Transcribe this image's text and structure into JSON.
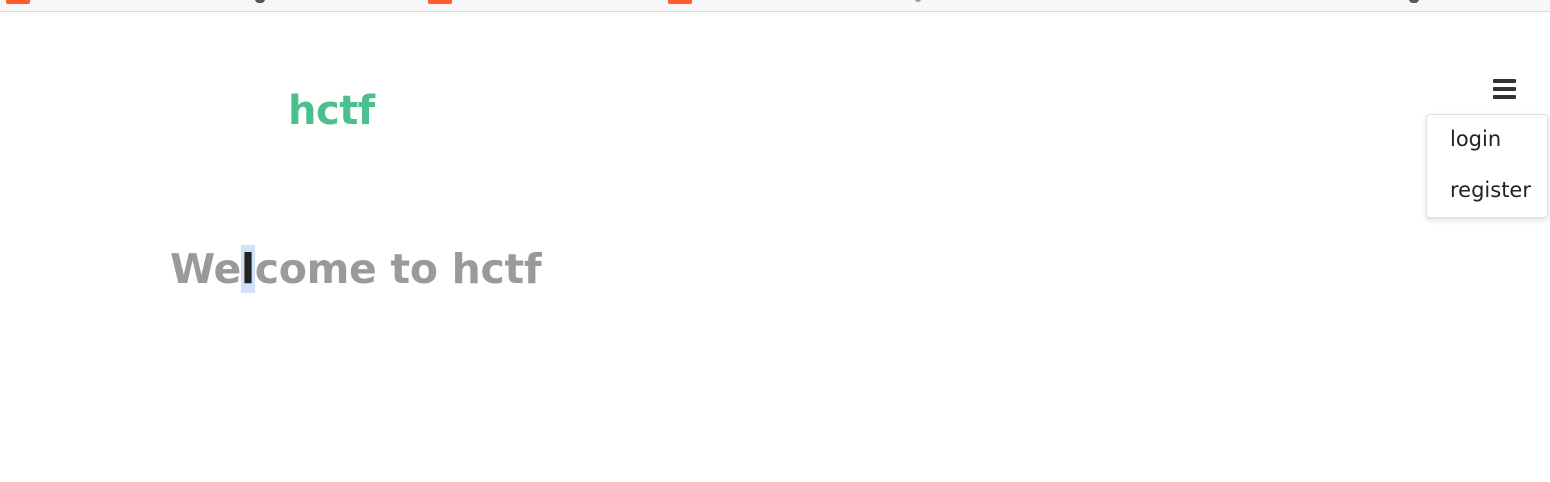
{
  "brand": {
    "title": "hctf"
  },
  "menu": {
    "icon": "hamburger-icon",
    "items": [
      {
        "label": "login"
      },
      {
        "label": "register"
      }
    ]
  },
  "hero": {
    "before_selection": "We",
    "selected": "l",
    "after_selection": "come to hctf"
  },
  "colors": {
    "brand": "#4cbf8f",
    "heading": "#9a9a9a",
    "selection": "#cfe1f7"
  }
}
